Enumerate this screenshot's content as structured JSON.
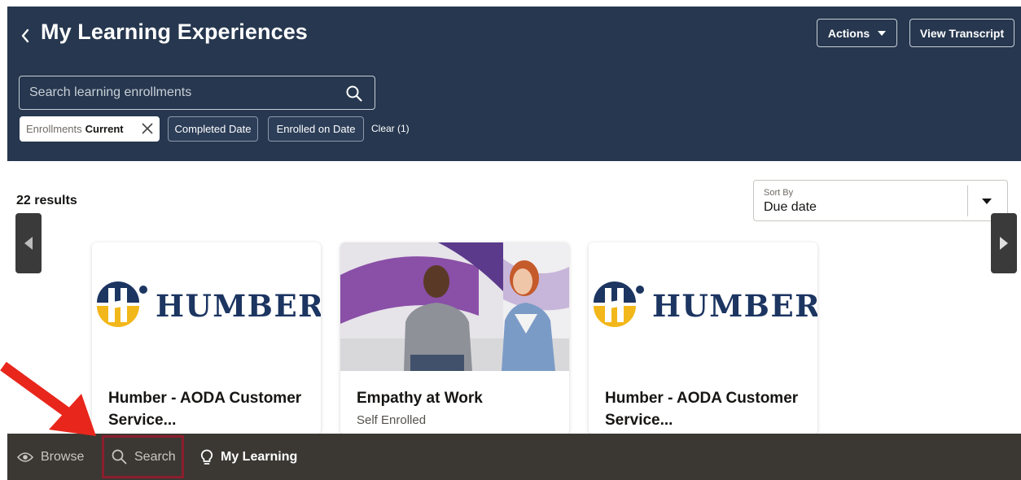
{
  "header": {
    "title": "My Learning Experiences",
    "actions_label": "Actions",
    "view_transcript_label": "View Transcript",
    "background_color": "#26374f"
  },
  "search": {
    "placeholder": "Search learning enrollments"
  },
  "filters": {
    "active_chip": {
      "label": "Enrollments",
      "value": "Current"
    },
    "chips": [
      "Completed Date",
      "Enrolled on Date"
    ],
    "clear_label": "Clear (1)"
  },
  "results": {
    "count_label": "22 results"
  },
  "sort": {
    "label": "Sort By",
    "value": "Due date"
  },
  "cards": [
    {
      "image": "humber-logo",
      "logo_text": "HUMBER",
      "title": "Humber - AODA Customer Service...",
      "subtitle": ""
    },
    {
      "image": "people-talking-photo",
      "logo_text": "",
      "title": "Empathy at Work",
      "subtitle": "Self Enrolled"
    },
    {
      "image": "humber-logo",
      "logo_text": "HUMBER",
      "title": "Humber - AODA Customer Service...",
      "subtitle": ""
    }
  ],
  "bottom_nav": {
    "items": [
      {
        "label": "Browse",
        "icon": "eye-icon"
      },
      {
        "label": "Search",
        "icon": "search-icon",
        "highlighted": true
      },
      {
        "label": "My Learning",
        "icon": "lightbulb-icon",
        "active": true
      }
    ],
    "background_color": "#3b3834",
    "highlight_color": "#8b1e2e"
  },
  "annotation": {
    "arrow_color": "#e8261c"
  }
}
